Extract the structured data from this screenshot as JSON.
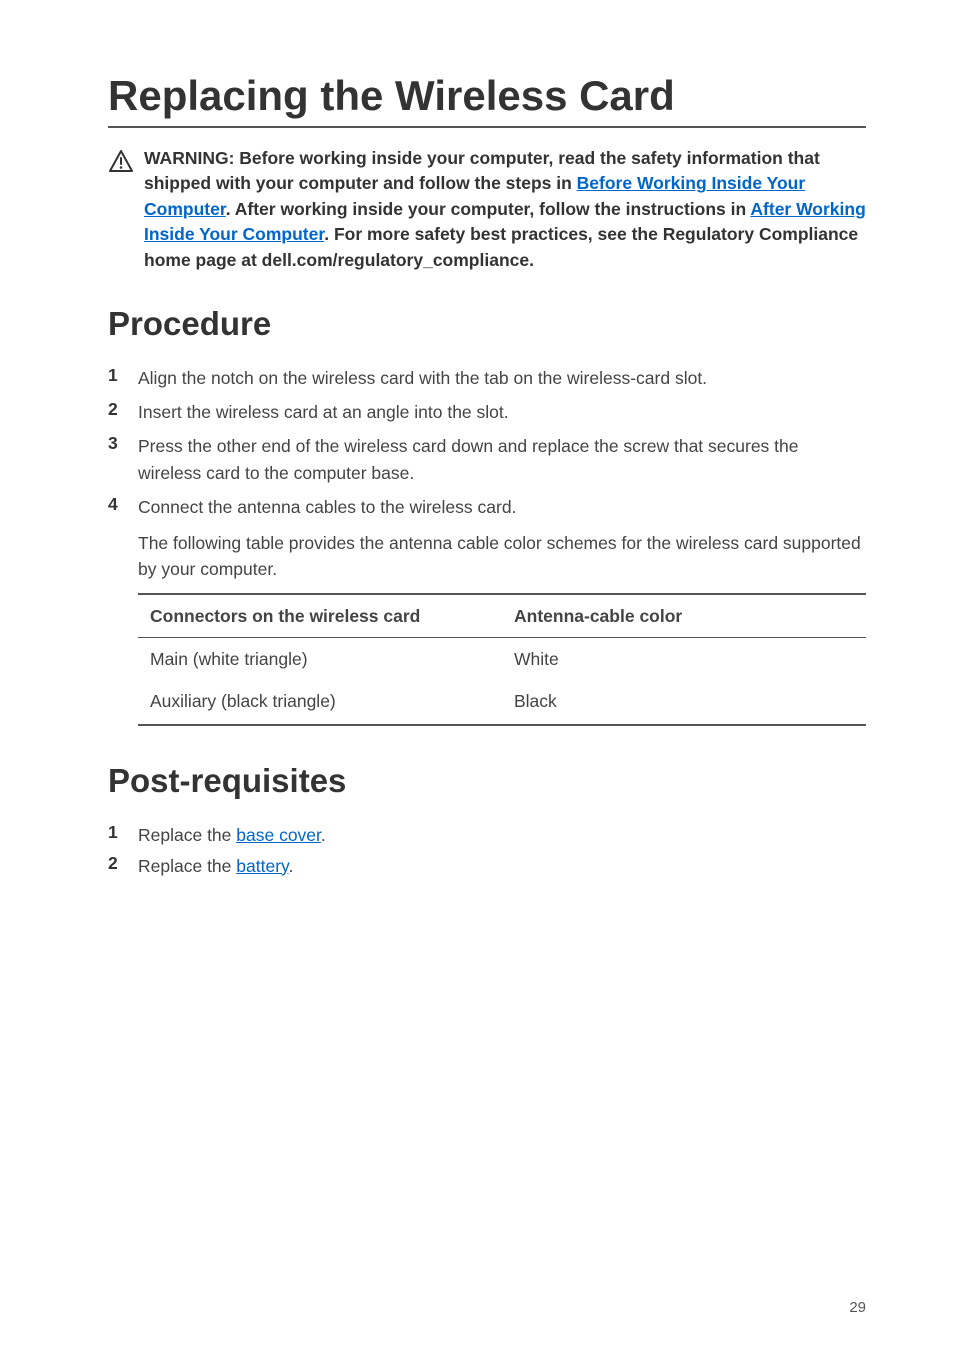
{
  "page_title": "Replacing the Wireless Card",
  "warning": {
    "prefix": "WARNING: Before working inside your computer, read the safety information that shipped with your computer and follow the steps in ",
    "link1": "Before Working Inside Your Computer",
    "mid1": ". After working inside your computer, follow the instructions in ",
    "link2": "After Working Inside Your Computer",
    "suffix": ". For more safety best practices, see the Regulatory Compliance home page at dell.com/regulatory_compliance."
  },
  "procedure_heading": "Procedure",
  "steps": {
    "s1": "Align the notch on the wireless card with the tab on the wireless-card slot.",
    "s2": "Insert the wireless card at an angle into the slot.",
    "s3": "Press the other end of the wireless card down and replace the screw that secures the wireless card to the computer base.",
    "s4_main": "Connect the antenna cables to the wireless card.",
    "s4_sub": "The following table provides the antenna cable color schemes for the wireless card supported by your computer."
  },
  "table": {
    "header_connector": "Connectors on the wireless card",
    "header_color": "Antenna-cable color",
    "rows": [
      {
        "connector": "Main (white triangle)",
        "color": "White"
      },
      {
        "connector": "Auxiliary (black triangle)",
        "color": "Black"
      }
    ]
  },
  "post_heading": "Post-requisites",
  "post": {
    "p1_prefix": "Replace the ",
    "p1_link": "base cover",
    "p1_suffix": ".",
    "p2_prefix": "Replace the ",
    "p2_link": "battery",
    "p2_suffix": "."
  },
  "page_num": "29"
}
